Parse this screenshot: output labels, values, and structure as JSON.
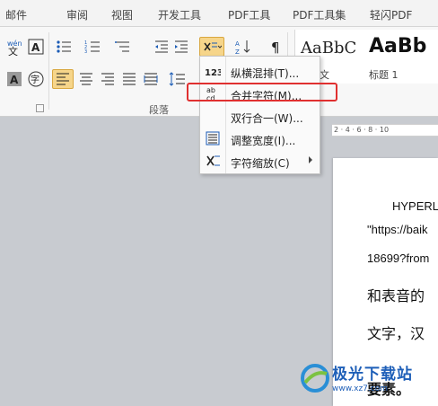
{
  "tabs": [
    "邮件",
    "审阅",
    "视图",
    "开发工具",
    "PDF工具",
    "PDF工具集",
    "轻闪PDF"
  ],
  "ribbon": {
    "group_label": "段落",
    "styles": [
      {
        "sample": "AaBbC",
        "name": "正文"
      },
      {
        "sample": "AaBb",
        "name": "标题 1"
      }
    ]
  },
  "ruler_text": "2 · 4 · 6 · 8 · 10",
  "menu": {
    "items": [
      {
        "label": "纵横混排(T)...",
        "icon": "vertical-horizontal-icon"
      },
      {
        "label": "合并字符(M)...",
        "icon": "combine-characters-icon"
      },
      {
        "label": "双行合一(W)...",
        "icon": "two-lines-in-one-icon"
      },
      {
        "label": "调整宽度(I)...",
        "icon": "adjust-width-icon"
      },
      {
        "label": "字符缩放(C)",
        "icon": "character-scale-icon"
      }
    ]
  },
  "document": {
    "lines": [
      "HYPERL",
      "\"https://baik",
      "18699?from",
      "和表音的",
      "文字，汉",
      "要素。"
    ]
  },
  "watermark": {
    "text": "极光下载站",
    "url": "www.xz7.com"
  },
  "colors": {
    "highlight": "#e03030",
    "active_button": "#f6d58a"
  }
}
